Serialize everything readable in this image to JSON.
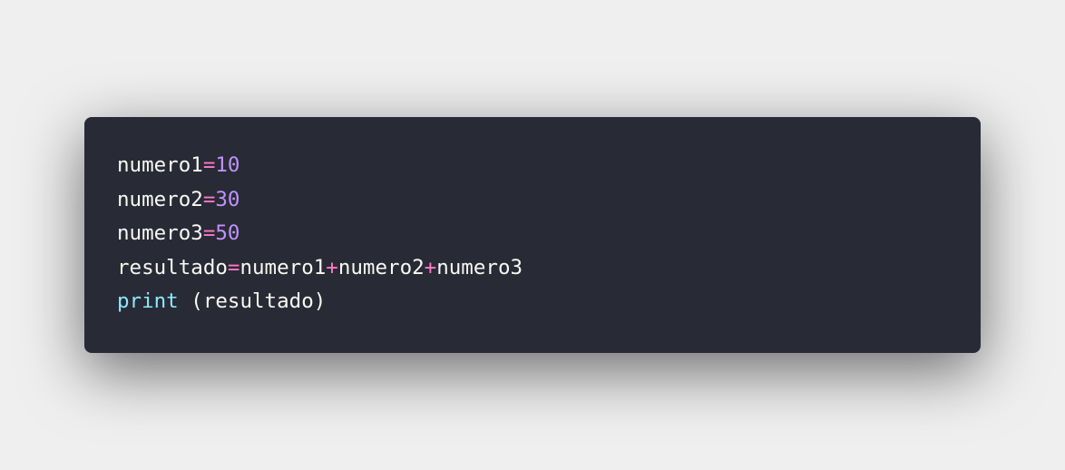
{
  "colors": {
    "page_background": "#efefef",
    "card_background": "#282a36",
    "identifier": "#f8f8f2",
    "operator": "#ff79c6",
    "number": "#bd93f9",
    "builtin": "#8be9fd"
  },
  "code": {
    "line1": {
      "var": "numero1",
      "op": "=",
      "num": "10"
    },
    "line2": {
      "var": "numero2",
      "op": "=",
      "num": "30"
    },
    "line3": {
      "var": "numero3",
      "op": "=",
      "num": "50"
    },
    "line4": {
      "var": "resultado",
      "op1": "=",
      "t1": "numero1",
      "op2": "+",
      "t2": "numero2",
      "op3": "+",
      "t3": "numero3"
    },
    "line5": {
      "fn": "print",
      "args": " (resultado)"
    }
  }
}
